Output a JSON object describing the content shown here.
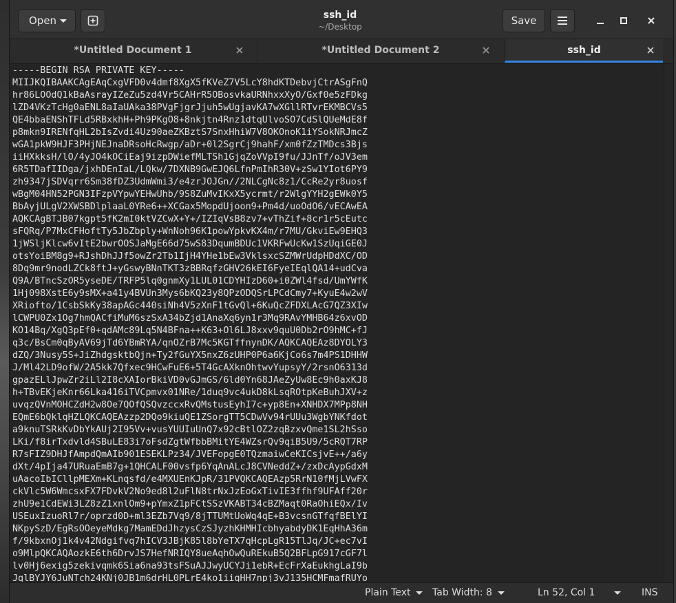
{
  "header": {
    "open_label": "Open",
    "save_label": "Save",
    "title": "ssh_id",
    "subtitle": "~/Desktop"
  },
  "tabs": [
    {
      "label": "*Untitled Document 1",
      "active": false
    },
    {
      "label": "*Untitled Document 2",
      "active": false
    },
    {
      "label": "ssh_id",
      "active": true
    }
  ],
  "editor": {
    "lines": [
      "-----BEGIN RSA PRIVATE KEY-----",
      "MIIJKQIBAAKCAgEAqCxgVFD0v4dmf8XgX5fKVeZ7V5LcY8hdKTDebvjCtrASgFnQ",
      "hr86LOOdQ1kBaAsrayIZeZu5zd4Vr5CAHrR5OBosvkaURNhxxXyO/Gxf0e5zFDkg",
      "lZD4VKzTcHg0aENL8aIaUAka38PVgFjgrJjuh5wUgjavKA7wXGllRTvrEKMBCVs5",
      "QE4bbaENShTFLd5RBxkhH+Ph9PKgO8+8nkjtn4Rnz1dtqUlvoSO7CdSlQUeMdE8f",
      "p8mkn9IRENfqHL2bIsZvdi4Uz90aeZKBztS7SnxHhiW7V8OKOnoK1iYSokNRJmcZ",
      "wGA1pkW9HJF3PHjNEJnaDRsoHcRwgp/aDr+0l2SgrCj9hahF/xm0fZzTMDcs3Bjs",
      "iiHXkksH/lO/4yJO4kOCiEaj9izpDWiefMLTSh1GjqZoVVpI9fu/JJnTf/oJV3em",
      "6R5TDafIIDga/jxhDEnIaL/LQkw/7DXNB9GwEJQ6LfnPmIhR30V+zSw1YIot6PY9",
      "zh9347jSDVqrr6Sm38fDZ3UdmWmi3/e4zrJOJGn//2NLCgNc8z1/CcRe2yr8uosf",
      "wBgM04HN52PGN3IFzpVYpwYEHwUhb/9S8ZuMvIKxX5ycrmt/r2WlgYYH2gEWk0Y5",
      "BbAyjULgV2XWSBDlplaaL0YRe6++XCGax5MopdUjoon9+Pm4d/uoOdO6/vECAwEA",
      "AQKCAgBTJB07kgpt5fK2mI0ktVZCwX+Y+/IZIqVsB8zv7+vThZif+8cr1r5cEutc",
      "sFQRq/P7MxCFHoftTy5JbZbply+WnNoh96K1powYpkvKX4m/r7MU/GkviEw9EHQ3",
      "1jWSljKlcw6vItE2bwrOOSJaMgE66d75wS83DqumBDUc1VKRFwUcKw1SzUqiGE0J",
      "otsYoiBM8g9+RJshDhJJf5owZr2Tb1IjH4YHe1bEw3VklsxcSZMWrUdpHDdXC/OD",
      "8Dq9mr9nodLZCk8ftJ+yGswyBNnTKT3zBBRqfzGHV26kEI6FyeIEqlQA14+udCva",
      "Q9A/BTncSzOR5yseDE/TRFP5lq0gnmXy1LUL01CDYHIzD60+i0ZWl4fsd/UmYWfK",
      "1Hj098XstE6y9sMX+a41y4BVUn3Mys6bKQ23y8QPzODQSrLPCdCmy7+KyuE4w2wV",
      "XRiofto/1CsbSkKy38apAGc440siNh4V5zXnF1tGvQl+6KuQcZFDXLAcG7QZ3XIw",
      "lCWPU0Zx1Og7hmQACfiMuM6szSxA34bZjd1AnaXq6yn1r3Mq9RAvYMHB64z6xvOD",
      "KO14Bq/XgQ3pEf0+qdAMc89Lq5N4BFna++K63+Ol6LJ8xxv9quU0Db2rO9hMC+fJ",
      "q3c/BsCm0qByAV69jTd6YBmRYA/qnOZrB7Mc5KGTffnynDK/AQKCAQEAz8DYOLY3",
      "dZQ/3Nusy5S+JiZhdgsktbQjn+Ty2fGuYX5nxZ6zUHP0P6a6KjCo6s7m4PS1DHHW",
      "J/Ml42LD9ofW/2A5kk7Qfxec9HCwFuE6+5T4GcAXknOhtwvYupsyY/2rsnO6313d",
      "gpazELlJpwZr2iLl2I8cXAIorBkiVD0vGJmGS/6ld0Yn68JAeZyUw8Ec9h0axKJ8",
      "h+TBvEKjeKnr66Lka416iTVCpmvx01NRe/1duq9vc4ukD8kLsqROtpKeBuhJXV+z",
      "uvqzQVnMOHCZdH2w8Oe7QOfQSQvzccxRvQMstusEyhI7c+yp8En+XNHDX7MPp8NH",
      "EQmE6bQklqHZLQKCAQEAzzp2DQo9kiuQE1ZSorgTT5CDwVv94rUUu3WgbYNKfdot",
      "a9knuTSRkKvDbYkAUj2I95Vv+vusYUUIuUnQ7x92cBtlOZ2zqBzxvQme1SL2hSso",
      "LKi/f8irTxdvld4SBuLE83i7oFsdZgtWfbbBMitYE4WZsrQv9qiB5U9/5cRQT7RP",
      "R7sFIZ9DHJfAmpdQmAIb901ESEKLPz34/JVEFopgE0TQzmaiwCeKICsjvE++/a6y",
      "dXt/4pIja47URuaEmB7g+1QHCALF00vsfp6YqAnALcJ8CVNeddZ+/zxDcAypGdxM",
      "uAacoIbICllpMEXm+KLnqsfd/e4MXUEnKJpR/31PVQKCAQEAzp5RrN10fMjLVwFX",
      "ckVlc5W6WmcsxFX7FDvkV2No9ed8l2uFlN8trNxJzEoGxTivIE3ffhf9UFAff20r",
      "zhU9e1CdEWi3LZ8zZ1xnlOm9+pYmxZ1pFCtSSzVKABT34cBZMaqt0RaOhiEQx/Iv",
      "USEuxIzuoRl7r/oprzd0D+ml3EZb7Vq9/8jTTUMtUoWq4qE+B3vcsnGTfqfBElYI",
      "NKpySzD/EgRsOOeyeMdkg7MamEDdJhzysCzSJyzhKHMHIcbhyabdyDK1EqHhA36m",
      "f/9kbxnOj1k4v42Ndgifvq7hICV3JBjK85l8bYeTX7qHcpLgR15TlJq/JC+ec7vI",
      "o9MlpQKCAQAozkE6th6DrvJS7HefNRIQY8ueAqhOwQuREkuB5Q2BFLpG917cGF7l",
      "lv0Hj6exig5zekivqmk6Sia6na93tsFSuAJJwyUCYJi1ebR+EcFrXaEukhgLaI9b",
      "JqlBYJY6JuNTch24KNj0JB1m6drHL0PLrE4ko1iigHH7npj3vJ135HCMFmafRUYo"
    ]
  },
  "status": {
    "language": "Plain Text",
    "tab_width": "Tab Width: 8",
    "position": "Ln 52, Col 1",
    "mode": "INS"
  },
  "icons": {
    "new_tab": "new-tab-icon",
    "menu": "hamburger-menu-icon",
    "minimize": "minimize-icon",
    "maximize": "maximize-icon",
    "close": "close-icon"
  }
}
